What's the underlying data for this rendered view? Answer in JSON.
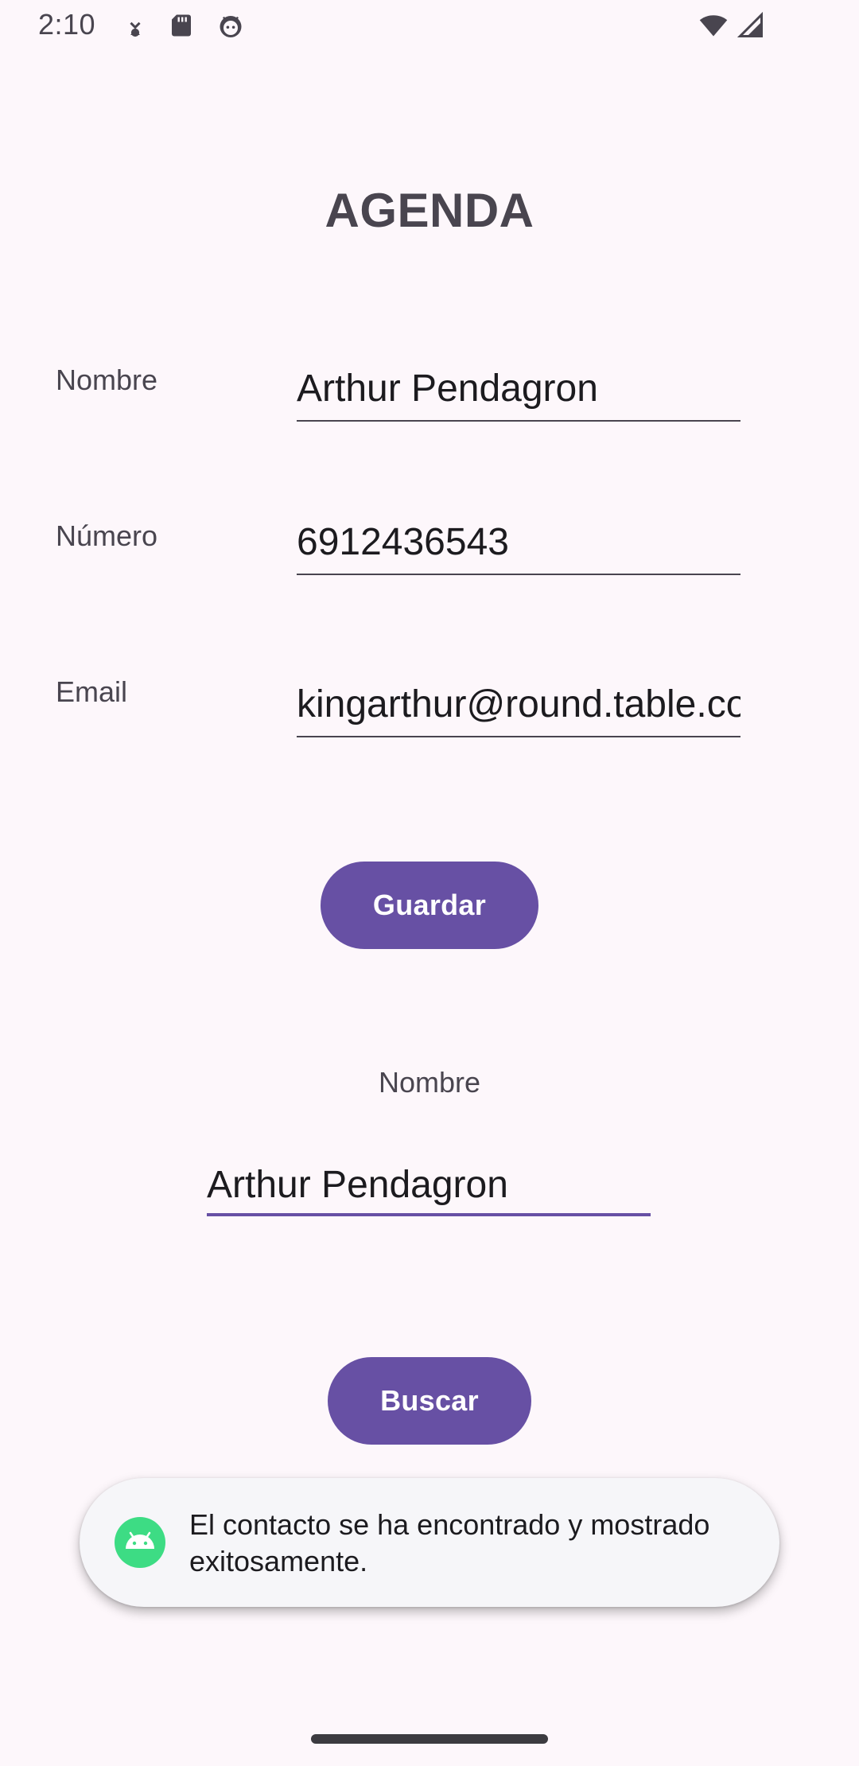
{
  "status_bar": {
    "time": "2:10",
    "icons": [
      "download-icon",
      "sd-card-icon",
      "face-icon",
      "wifi-icon",
      "signal-icon"
    ]
  },
  "header": {
    "title": "AGENDA"
  },
  "form": {
    "name_label": "Nombre",
    "name_value": "Arthur Pendagron",
    "number_label": "Número",
    "number_value": "6912436543",
    "email_label": "Email",
    "email_value": "kingarthur@round.table.com",
    "save_label": "Guardar"
  },
  "search": {
    "label": "Nombre",
    "value": "Arthur Pendagron",
    "search_label": "Buscar"
  },
  "toast": {
    "icon": "android-icon",
    "message": "El contacto se ha encontrado y mostrado exitosamente."
  },
  "colors": {
    "background": "#FDF7FB",
    "primary": "#6750A4",
    "text": "#1C1B1F",
    "secondary_text": "#49454F",
    "toast_background": "#F6F6F9",
    "android_green": "#3DDC84"
  }
}
